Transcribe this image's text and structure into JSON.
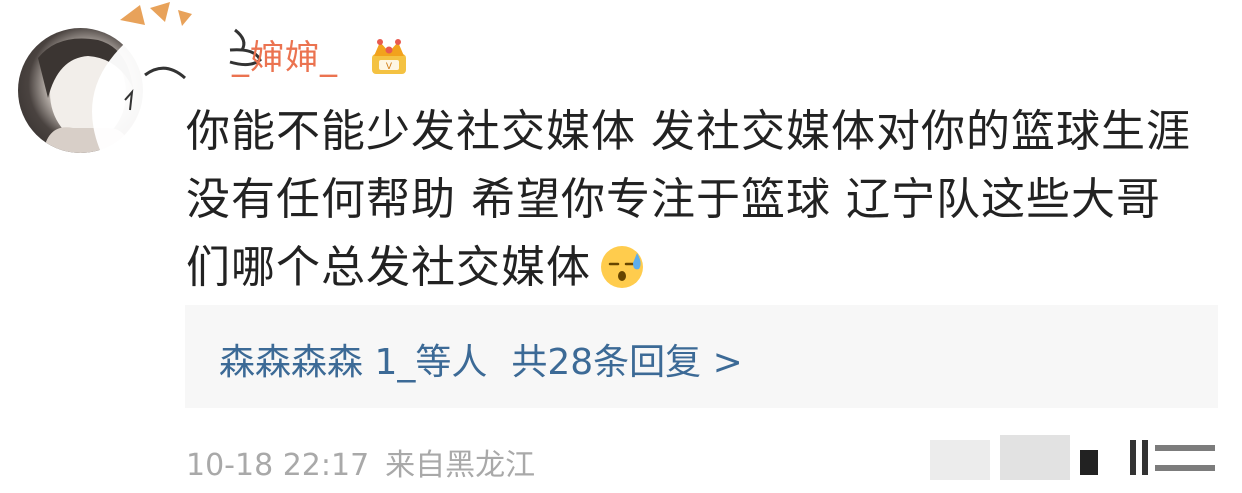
{
  "comment": {
    "username": "_婶婶_",
    "lines": [
      "你能不能少发社交媒体 发社交媒体对你的篮球生涯",
      "没有任何帮助 希望你专注于篮球 辽宁队这些大哥",
      "们哪个总发社交媒体"
    ],
    "emoji": "sweat-emoji",
    "badge": "crown-badge-icon",
    "reply_summary": {
      "users": "森森森森 1_",
      "suffix": "等人",
      "count_text": "共28条回复 >"
    },
    "timestamp": "10-18 22:17",
    "location": "来自黑龙江"
  },
  "colors": {
    "username": "#eb7350",
    "text": "#222222",
    "link": "#3c6a96",
    "meta": "#a9a9a9",
    "reply_bg": "#f7f7f7"
  }
}
